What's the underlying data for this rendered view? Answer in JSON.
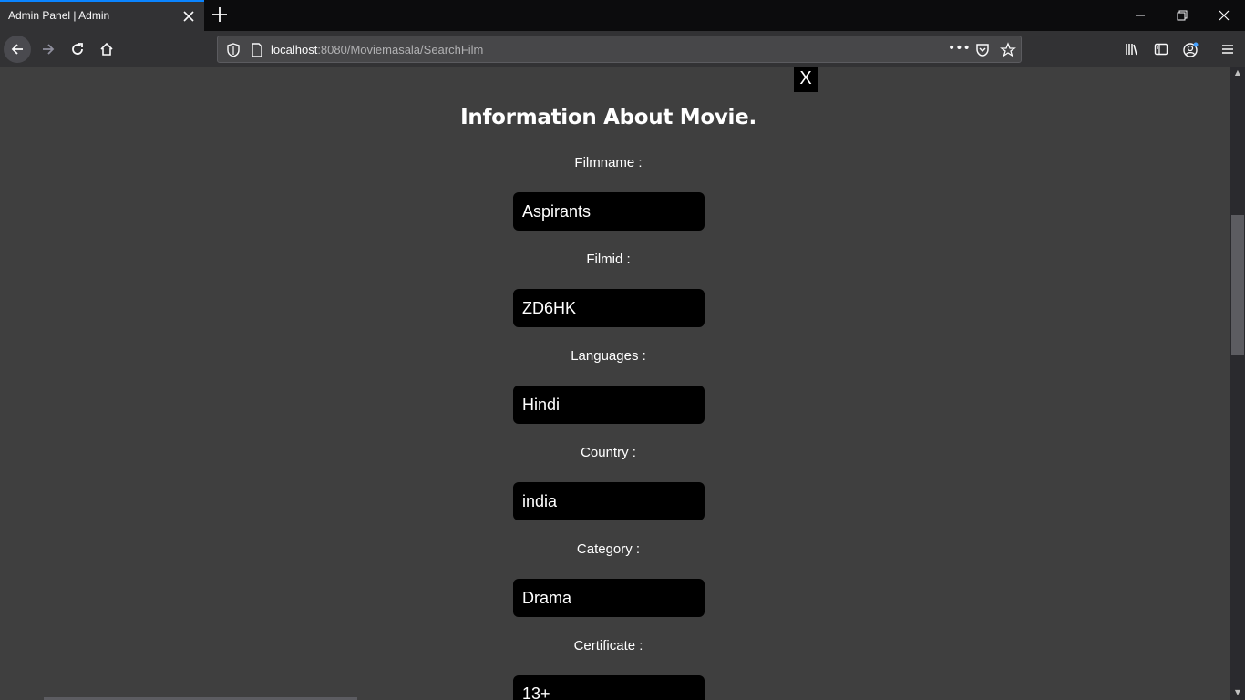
{
  "browser": {
    "tab_title": "Admin Panel | Admin",
    "url_host": "localhost",
    "url_rest": ":8080/Moviemasala/SearchFilm",
    "url_more": "•••"
  },
  "modal": {
    "close_label": "X",
    "title": "Information About Movie.",
    "fields": [
      {
        "label": "Filmname :",
        "value": "Aspirants"
      },
      {
        "label": "Filmid :",
        "value": "ZD6HK"
      },
      {
        "label": "Languages :",
        "value": "Hindi"
      },
      {
        "label": "Country :",
        "value": "india"
      },
      {
        "label": "Category :",
        "value": "Drama"
      },
      {
        "label": "Certificate :",
        "value": "13+"
      }
    ]
  },
  "icons": {
    "accent": "#0a84ff",
    "profile_dot": "#45a1ff"
  }
}
